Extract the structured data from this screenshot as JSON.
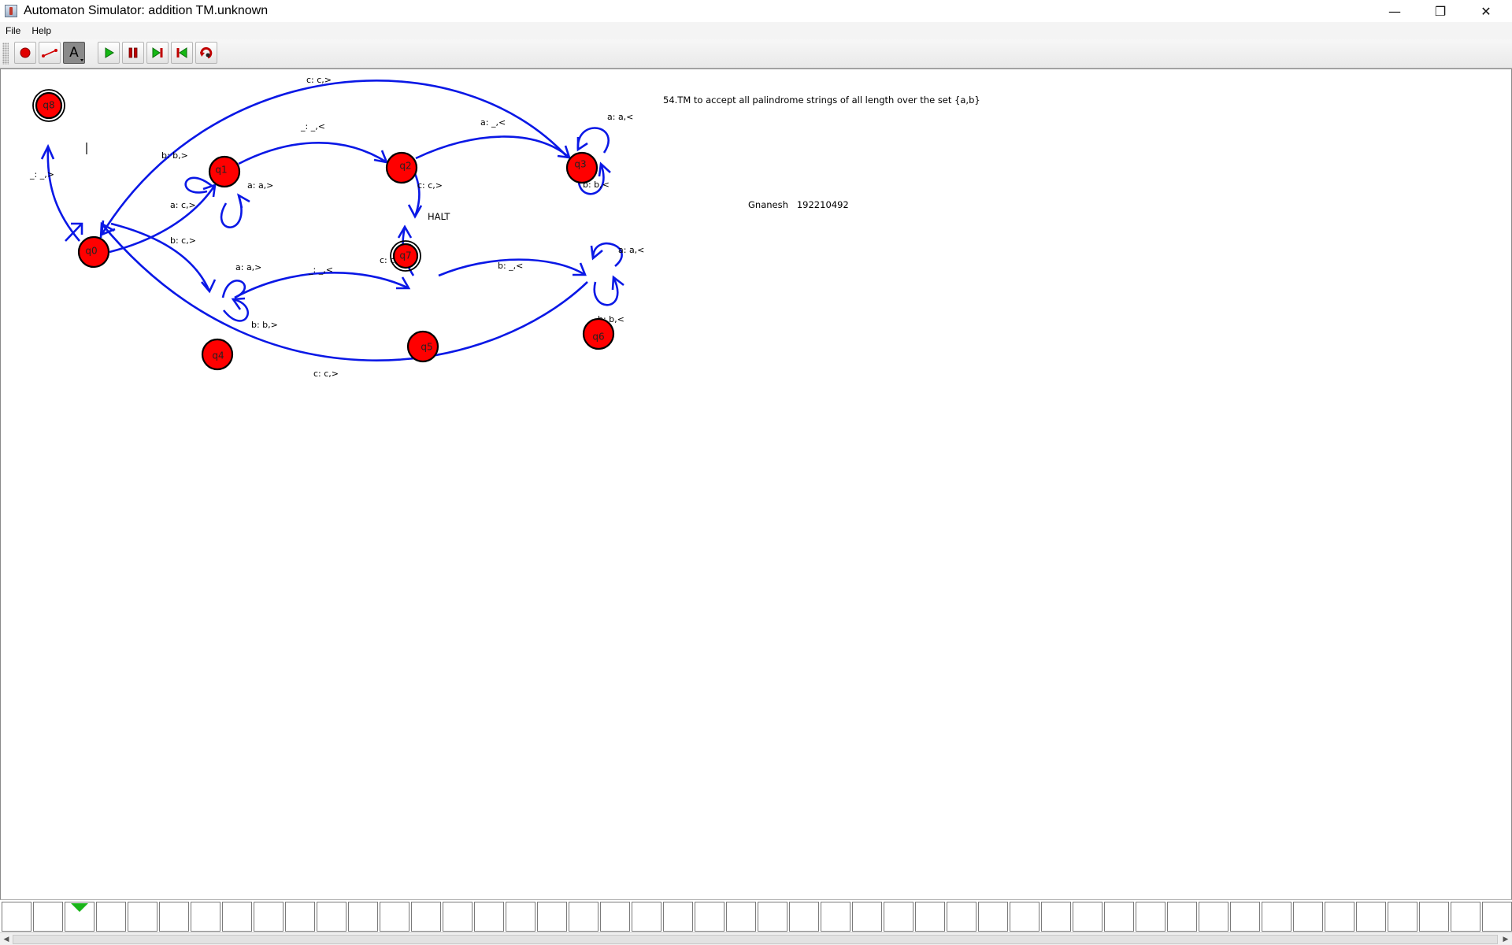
{
  "window": {
    "title": "Automaton Simulator: addition TM.unknown",
    "controls": {
      "minimize": "—",
      "maximize": "❐",
      "close": "✕"
    }
  },
  "menu": [
    "File",
    "Help"
  ],
  "toolbar": {
    "tools": [
      {
        "name": "state-tool",
        "icon": "red-dot-icon"
      },
      {
        "name": "transition-tool",
        "icon": "transition-line-icon"
      },
      {
        "name": "text-tool",
        "icon": "letter-a-icon",
        "glyph": "A",
        "pressed": true
      },
      {
        "name": "run",
        "icon": "play-icon"
      },
      {
        "name": "pause",
        "icon": "pause-icon"
      },
      {
        "name": "step-forward",
        "icon": "step-forward-icon"
      },
      {
        "name": "step-back",
        "icon": "step-back-icon"
      },
      {
        "name": "reset",
        "icon": "reset-icon"
      }
    ],
    "colors": {
      "play": "#14b814",
      "pause": "#c00000",
      "dot": "#e00000"
    }
  },
  "canvas": {
    "description_text": "54.TM to accept all palindrome strings of all length over the set {a,b}",
    "author": "Gnanesh   192210492",
    "halt_label": "HALT",
    "states": [
      {
        "id": "q0",
        "label": "q0",
        "final": false,
        "start": true
      },
      {
        "id": "q1",
        "label": "q1",
        "final": false
      },
      {
        "id": "q2",
        "label": "q2",
        "final": false
      },
      {
        "id": "q3",
        "label": "q3",
        "final": false
      },
      {
        "id": "q4",
        "label": "q4",
        "final": false
      },
      {
        "id": "q5",
        "label": "q5",
        "final": false
      },
      {
        "id": "q6",
        "label": "q6",
        "final": false
      },
      {
        "id": "q7",
        "label": "q7",
        "final": true
      },
      {
        "id": "q8",
        "label": "q8",
        "final": true
      }
    ],
    "transitions": [
      {
        "from": "q0",
        "to": "q1",
        "label": "a: c,>"
      },
      {
        "from": "q1",
        "to": "q1",
        "label": "b: b,>"
      },
      {
        "from": "q1",
        "to": "q1",
        "label": "a: a,>"
      },
      {
        "from": "q1",
        "to": "q2",
        "label": "_: _,<"
      },
      {
        "from": "q2",
        "to": "q3",
        "label": "a: _,<"
      },
      {
        "from": "q3",
        "to": "q3",
        "label": "a: a,<"
      },
      {
        "from": "q3",
        "to": "q3",
        "label": "b: b,<"
      },
      {
        "from": "q3",
        "to": "q0",
        "label": "c: c,>"
      },
      {
        "from": "q2",
        "to": "q7",
        "label": "c: c,>"
      },
      {
        "from": "q0",
        "to": "q4",
        "label": "b: c,>"
      },
      {
        "from": "q4",
        "to": "q4",
        "label": "a: a,>"
      },
      {
        "from": "q4",
        "to": "q4",
        "label": "b: b,>"
      },
      {
        "from": "q4",
        "to": "q5",
        "label": "_: _,<"
      },
      {
        "from": "q5",
        "to": "q6",
        "label": "b: _,<"
      },
      {
        "from": "q6",
        "to": "q6",
        "label": "a: a,<"
      },
      {
        "from": "q6",
        "to": "q6",
        "label": "b: b,<"
      },
      {
        "from": "q6",
        "to": "q0",
        "label": "c: c,>"
      },
      {
        "from": "q5",
        "to": "q7",
        "label": "c: c,>"
      },
      {
        "from": "q0",
        "to": "q8",
        "label": "_: _,>"
      }
    ],
    "edge_color": "#0a18e6",
    "state_color": "#ff0000"
  },
  "tape": {
    "cells": [
      "",
      "",
      "",
      "",
      "",
      "",
      "",
      "",
      "",
      "",
      "",
      "",
      "",
      "",
      "",
      "",
      "",
      "",
      "",
      "",
      "",
      "",
      "",
      "",
      "",
      "",
      "",
      "",
      "",
      "",
      "",
      "",
      "",
      "",
      "",
      "",
      "",
      "",
      "",
      "",
      "",
      "",
      "",
      "",
      "",
      "",
      "",
      ""
    ],
    "head_index": 2,
    "head_color": "#1ab51a"
  }
}
